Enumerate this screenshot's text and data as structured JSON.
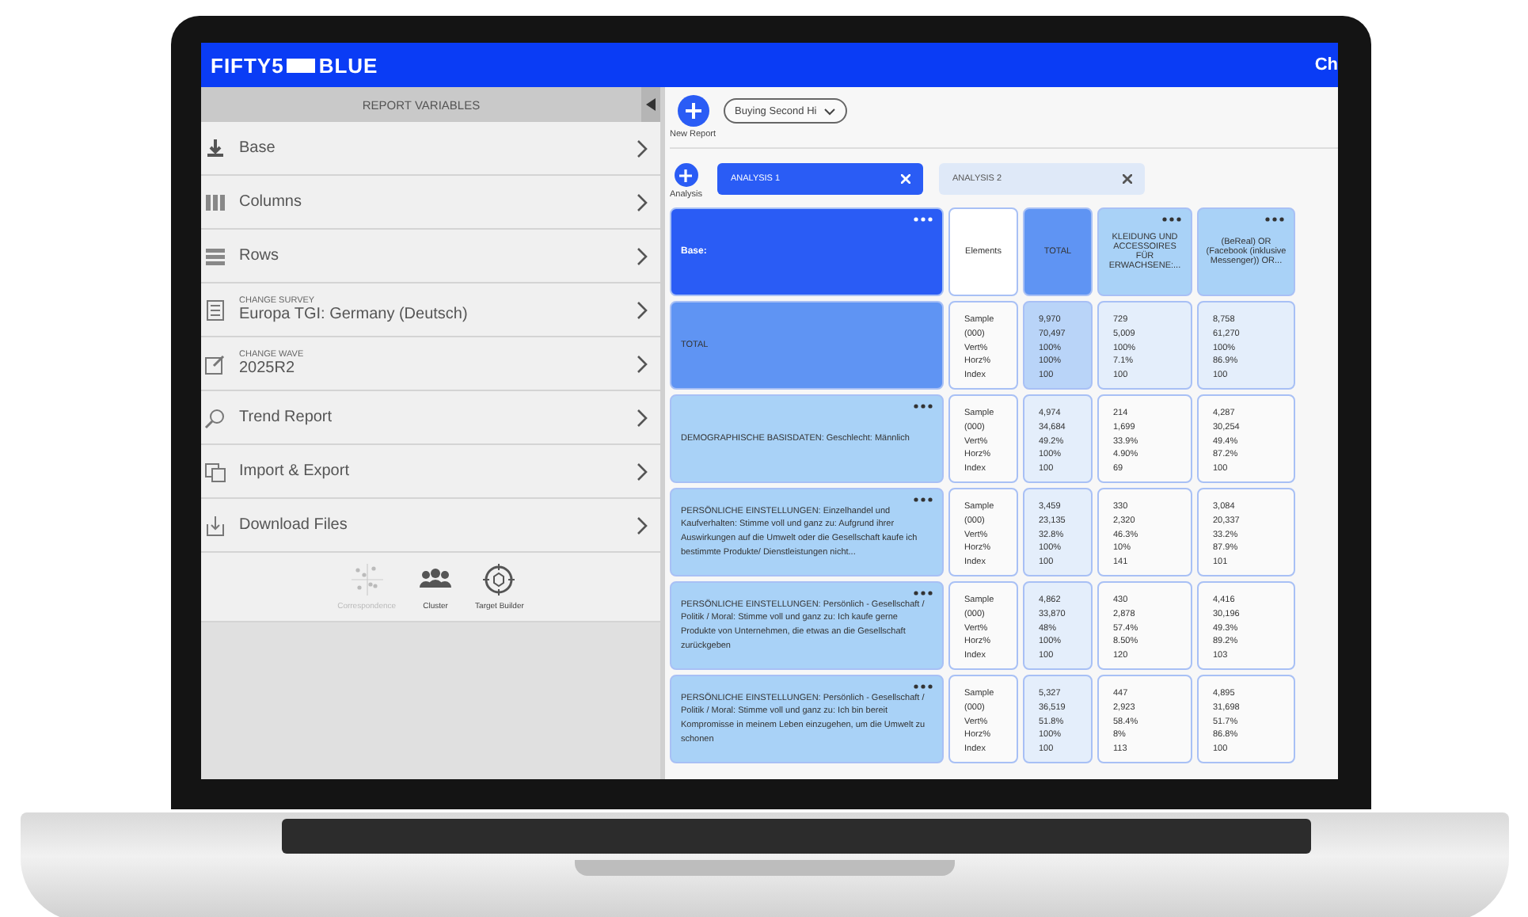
{
  "app": {
    "logo_left": "FIFTY5",
    "logo_right": "BLUE",
    "header_right": "Ch"
  },
  "sidebar": {
    "title": "REPORT VARIABLES",
    "items": [
      {
        "label": "Base"
      },
      {
        "label": "Columns"
      },
      {
        "label": "Rows"
      },
      {
        "caption": "CHANGE SURVEY",
        "label": "Europa TGI: Germany (Deutsch)"
      },
      {
        "caption": "CHANGE WAVE",
        "label": "2025R2"
      },
      {
        "label": "Trend Report"
      },
      {
        "label": "Import & Export"
      },
      {
        "label": "Download Files"
      }
    ],
    "tools": [
      {
        "label": "Correspondence",
        "disabled": true
      },
      {
        "label": "Cluster",
        "disabled": false
      },
      {
        "label": "Target Builder",
        "disabled": false
      }
    ]
  },
  "toolbar": {
    "new_report_label": "New Report",
    "report_dropdown": "Buying Second Hi"
  },
  "analysis": {
    "add_label": "Analysis",
    "tabs": [
      {
        "label": "ANALYSIS 1",
        "selected": true
      },
      {
        "label": "ANALYSIS 2",
        "selected": false
      }
    ]
  },
  "table": {
    "columns": [
      {
        "kind": "base",
        "label": "Base:"
      },
      {
        "kind": "elements",
        "label": "Elements"
      },
      {
        "kind": "total",
        "label": "TOTAL"
      },
      {
        "kind": "variable",
        "label": "KLEIDUNG UND ACCESSOIRES FÜR ERWACHSENE:..."
      },
      {
        "kind": "variable",
        "label": "(BeReal) OR (Facebook (inklusive Messenger)) OR..."
      }
    ],
    "rows": [
      {
        "kind": "total",
        "cells": [
          "TOTAL",
          [
            "Sample",
            "(000)",
            "Vert%",
            "Horz%",
            "Index"
          ],
          [
            "9,970",
            "70,497",
            "100%",
            "100%",
            "100"
          ],
          [
            "729",
            "5,009",
            "100%",
            "7.1%",
            "100"
          ],
          [
            "8,758",
            "61,270",
            "100%",
            "86.9%",
            "100"
          ]
        ]
      },
      {
        "kind": "category",
        "cells": [
          "DEMOGRAPHISCHE BASISDATEN: Geschlecht: Männlich",
          [
            "Sample",
            "(000)",
            "Vert%",
            "Horz%",
            "Index"
          ],
          [
            "4,974",
            "34,684",
            "49.2%",
            "100%",
            "100"
          ],
          [
            "214",
            "1,699",
            "33.9%",
            "4.90%",
            "69"
          ],
          [
            "4,287",
            "30,254",
            "49.4%",
            "87.2%",
            "100"
          ]
        ]
      },
      {
        "kind": "category",
        "cells": [
          "PERSÖNLICHE EINSTELLUNGEN: Einzelhandel und Kaufverhalten: Stimme voll und ganz zu: Aufgrund ihrer Auswirkungen auf die Umwelt oder die Gesellschaft kaufe ich bestimmte Produkte/ Dienstleistungen nicht...",
          [
            "Sample",
            "(000)",
            "Vert%",
            "Horz%",
            "Index"
          ],
          [
            "3,459",
            "23,135",
            "32.8%",
            "100%",
            "100"
          ],
          [
            "330",
            "2,320",
            "46.3%",
            "10%",
            "141"
          ],
          [
            "3,084",
            "20,337",
            "33.2%",
            "87.9%",
            "101"
          ]
        ]
      },
      {
        "kind": "category",
        "cells": [
          "PERSÖNLICHE EINSTELLUNGEN: Persönlich - Gesellschaft / Politik / Moral: Stimme voll und ganz zu: Ich kaufe gerne Produkte von Unternehmen, die etwas an die Gesellschaft zurückgeben",
          [
            "Sample",
            "(000)",
            "Vert%",
            "Horz%",
            "Index"
          ],
          [
            "4,862",
            "33,870",
            "48%",
            "100%",
            "100"
          ],
          [
            "430",
            "2,878",
            "57.4%",
            "8.50%",
            "120"
          ],
          [
            "4,416",
            "30,196",
            "49.3%",
            "89.2%",
            "103"
          ]
        ]
      },
      {
        "kind": "category",
        "cells": [
          "PERSÖNLICHE EINSTELLUNGEN: Persönlich - Gesellschaft / Politik / Moral: Stimme voll und ganz zu: Ich bin bereit Kompromisse in meinem Leben einzugehen, um die Umwelt zu schonen",
          [
            "Sample",
            "(000)",
            "Vert%",
            "Horz%",
            "Index"
          ],
          [
            "5,327",
            "36,519",
            "51.8%",
            "100%",
            "100"
          ],
          [
            "447",
            "2,923",
            "58.4%",
            "8%",
            "113"
          ],
          [
            "4,895",
            "31,698",
            "51.7%",
            "86.8%",
            "100"
          ]
        ]
      }
    ]
  }
}
